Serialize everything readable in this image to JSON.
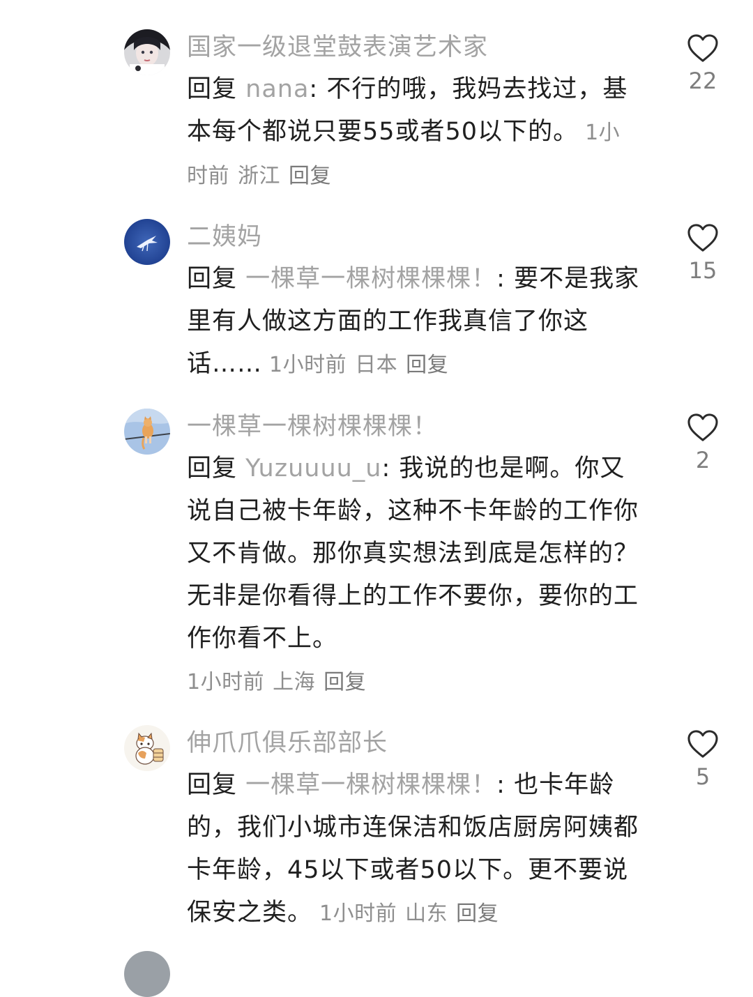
{
  "comments": [
    {
      "username": "国家一级退堂鼓表演艺术家",
      "reply_prefix": "回复",
      "reply_to": "nana",
      "separator": ": ",
      "text": "不行的哦，我妈去找过，基本每个都说只要55或者50以下的。",
      "time": "1小时前",
      "location": "浙江",
      "reply_label": "回复",
      "likes": "22",
      "avatar_icon": "girl-portrait-avatar"
    },
    {
      "username": "二姨妈",
      "reply_prefix": "回复",
      "reply_to": "一棵草一棵树棵棵棵！",
      "separator": ": ",
      "text": "要不是我家里有人做这方面的工作我真信了你这话……",
      "time": "1小时前",
      "location": "日本",
      "reply_label": "回复",
      "likes": "15",
      "avatar_icon": "blue-bird-avatar"
    },
    {
      "username": "一棵草一棵树棵棵棵！",
      "reply_prefix": "回复",
      "reply_to": "Yuzuuuu_u",
      "separator": ": ",
      "text": "我说的也是啊。你又说自己被卡年龄，这种不卡年龄的工作你又不肯做。那你真实想法到底是怎样的？无非是你看得上的工作不要你，要你的工作你看不上。",
      "time": "1小时前",
      "location": "上海",
      "reply_label": "回复",
      "likes": "2",
      "avatar_icon": "cat-on-wire-avatar"
    },
    {
      "username": "伸爪爪俱乐部部长",
      "reply_prefix": "回复",
      "reply_to": "一棵草一棵树棵棵棵！",
      "separator": ": ",
      "text": "也卡年龄的，我们小城市连保洁和饭店厨房阿姨都卡年龄，45以下或者50以下。更不要说保安之类。",
      "time": "1小时前",
      "location": "山东",
      "reply_label": "回复",
      "likes": "5",
      "avatar_icon": "cartoon-cat-avatar"
    }
  ],
  "colors": {
    "username": "#a3a3a3",
    "body_text": "#1f1f1f",
    "meta": "#8e8e8e",
    "heart_stroke": "#2b2b2b"
  }
}
